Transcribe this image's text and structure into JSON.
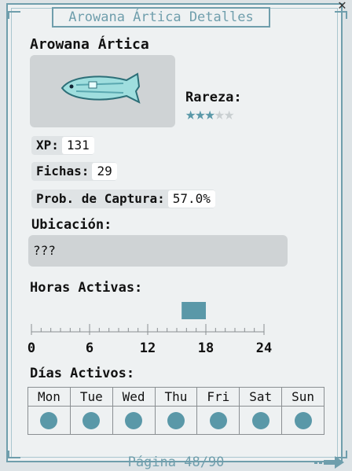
{
  "window": {
    "title": "Arowana Ártica Detalles"
  },
  "fish": {
    "name": "Arowana Ártica",
    "rarity_label": "Rareza:",
    "rarity_stars": 3,
    "rarity_max": 5
  },
  "stats": {
    "xp_label": "XP:",
    "xp_value": "131",
    "tokens_label": "Fichas:",
    "tokens_value": "29",
    "catch_label": "Prob. de Captura:",
    "catch_value": "57.0%"
  },
  "location": {
    "label": "Ubicación:",
    "value": "???"
  },
  "hours": {
    "label": "Horas Activas:",
    "ticks": [
      "0",
      "6",
      "12",
      "18",
      "24"
    ],
    "active_range": [
      15.5,
      18
    ]
  },
  "days": {
    "label": "Días Activos:",
    "names": [
      "Mon",
      "Tue",
      "Wed",
      "Thu",
      "Fri",
      "Sat",
      "Sun"
    ],
    "active": [
      true,
      true,
      true,
      true,
      true,
      true,
      true
    ]
  },
  "footer": {
    "page_text": "Página 48/90"
  },
  "colors": {
    "accent": "#5a98a8",
    "border": "#6f9eac"
  }
}
